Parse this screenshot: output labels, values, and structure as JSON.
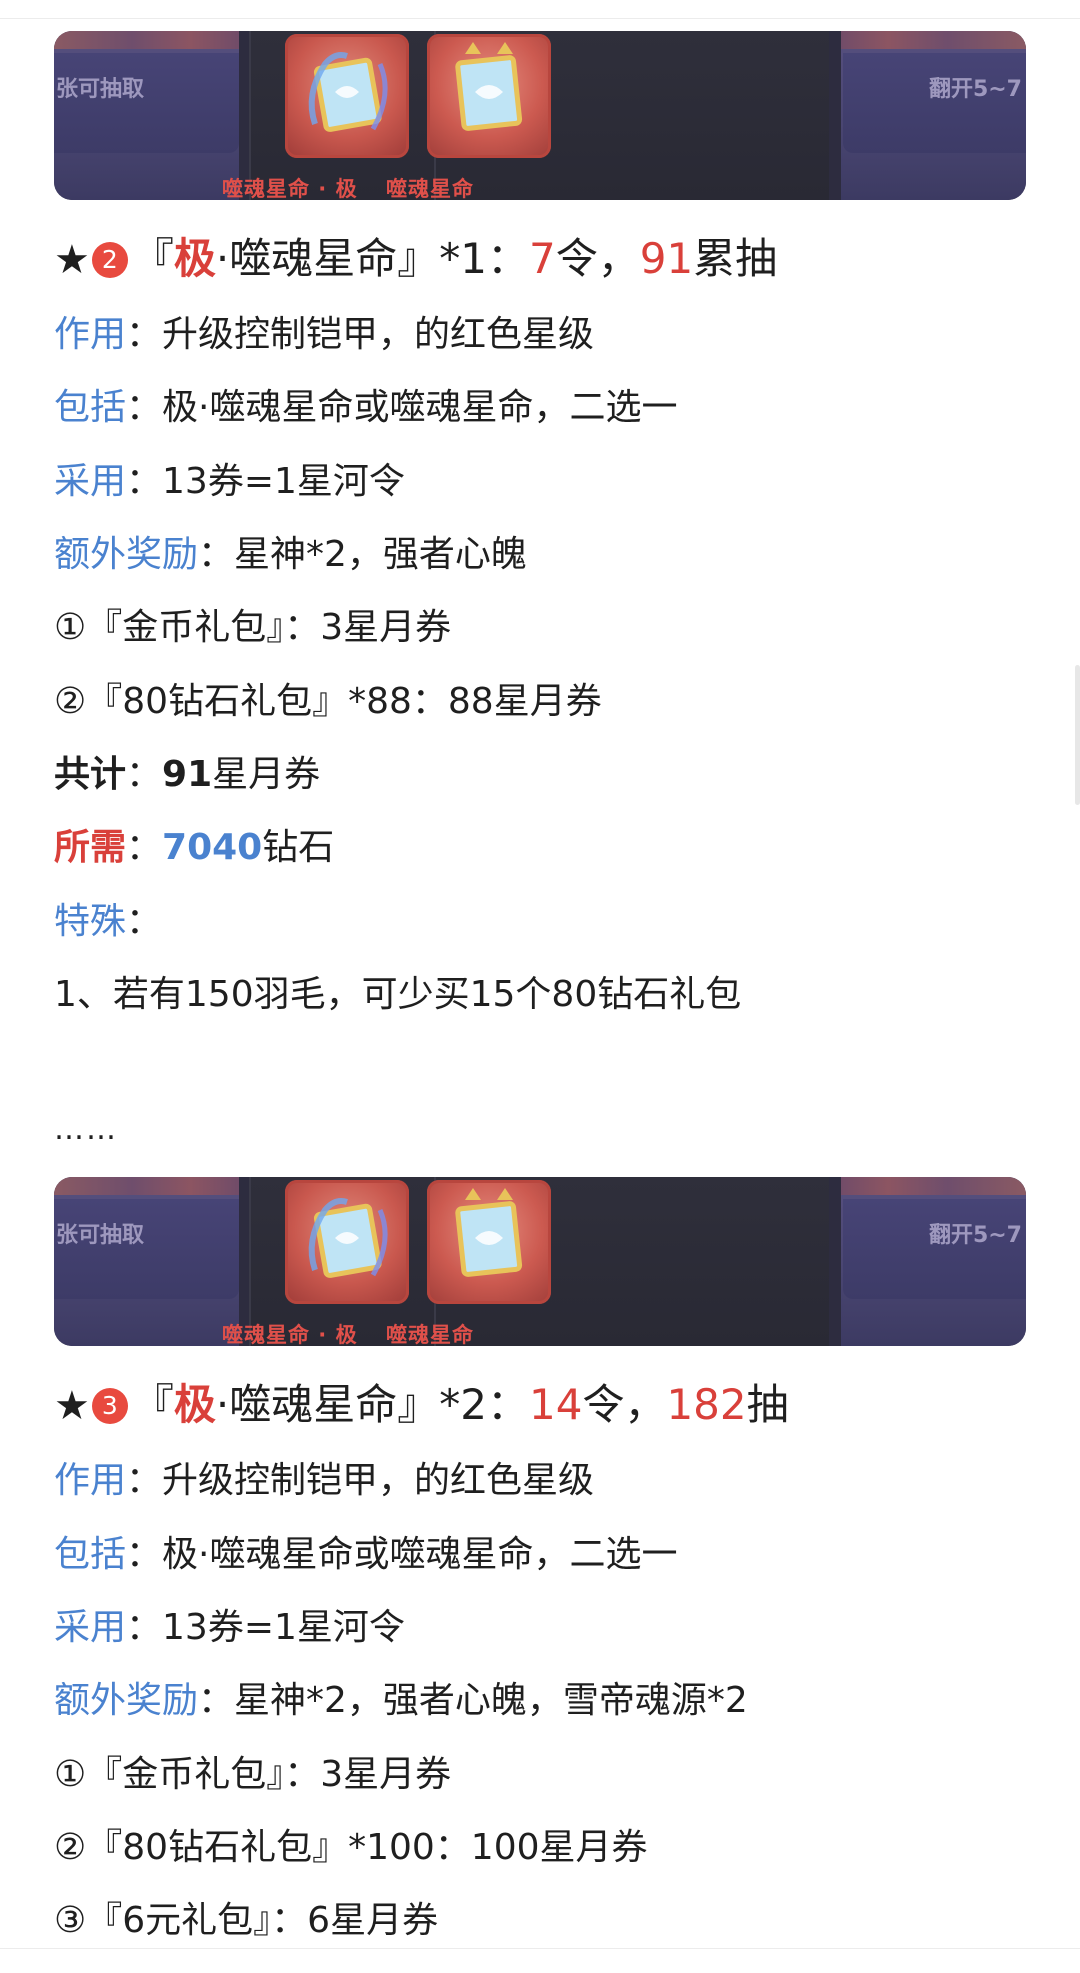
{
  "banner": {
    "left_text": "张可抽取",
    "right_text": "翻开5~7",
    "card1_label": "噬魂星命 · 极",
    "card2_label": "噬魂星命"
  },
  "sections": [
    {
      "badge": "2",
      "head": {
        "open": "『",
        "ji": "极",
        "name": "·噬魂星命』*1：",
        "n1": "7",
        "t1": "令，",
        "n2": "91",
        "t2": "累抽"
      },
      "zuoyong": {
        "label": "作用",
        "text": "：升级控制铠甲，的红色星级"
      },
      "baokuo": {
        "label": "包括",
        "text": "：极·噬魂星命或噬魂星命，二选一"
      },
      "caiyong": {
        "label": "采用",
        "text": "：13券=1星河令"
      },
      "ewai": {
        "label": "额外奖励",
        "text": "：星神*2，强者心魄"
      },
      "items": [
        "①『金币礼包』：3星月券",
        "②『80钻石礼包』*88：88星月券"
      ],
      "total": {
        "label": "共计",
        "sep": "：",
        "num": "91",
        "unit": "星月券"
      },
      "need": {
        "label": "所需",
        "sep": "：",
        "num": "7040",
        "unit": "钻石"
      },
      "special": {
        "label": "特殊",
        "sep": "："
      },
      "special_note": "1、若有150羽毛，可少买15个80钻石礼包"
    },
    {
      "badge": "3",
      "head": {
        "open": "『",
        "ji": "极",
        "name": "·噬魂星命』*2：",
        "n1": "14",
        "t1": "令，",
        "n2": "182",
        "t2": "抽"
      },
      "zuoyong": {
        "label": "作用",
        "text": "：升级控制铠甲，的红色星级"
      },
      "baokuo": {
        "label": "包括",
        "text": "：极·噬魂星命或噬魂星命，二选一"
      },
      "caiyong": {
        "label": "采用",
        "text": "：13券=1星河令"
      },
      "ewai": {
        "label": "额外奖励",
        "text": "：星神*2，强者心魄，雪帝魂源*2"
      },
      "items": [
        "①『金币礼包』：3星月券",
        "②『80钻石礼包』*100：100星月券",
        "③『6元礼包』：6星月券"
      ]
    }
  ],
  "ellipsis": "……",
  "colors": {
    "accent_red": "#d9403a",
    "accent_blue": "#4a82cf",
    "badge_red": "#e84a3f"
  }
}
